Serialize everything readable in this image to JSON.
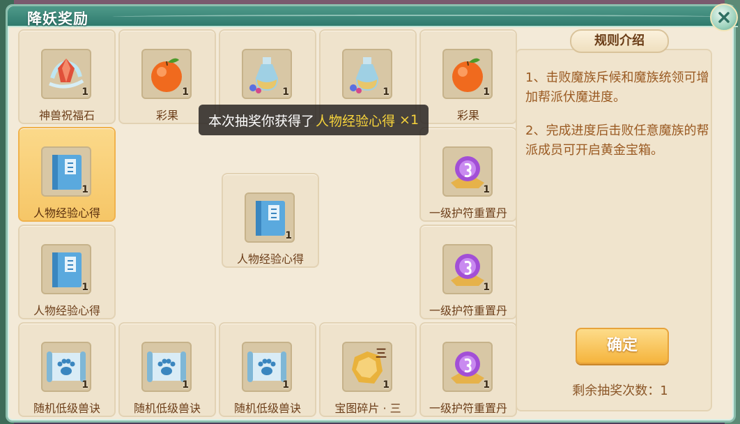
{
  "window": {
    "title": "降妖奖励"
  },
  "toast": {
    "prefix": "本次抽奖你获得了",
    "item": "人物经验心得",
    "multiplier": "×1"
  },
  "grid": {
    "cells": [
      {
        "label": "神兽祝福石",
        "qty": "1",
        "icon": "crystal-icon"
      },
      {
        "label": "彩果",
        "qty": "1",
        "icon": "fruit-icon"
      },
      {
        "label": "",
        "qty": "1",
        "icon": "potion-bottle-icon"
      },
      {
        "label": "",
        "qty": "1",
        "icon": "potion-bottle-icon"
      },
      {
        "label": "彩果",
        "qty": "1",
        "icon": "fruit-icon"
      },
      {
        "label": "人物经验心得",
        "qty": "1",
        "icon": "experience-book-icon",
        "selected": true
      },
      {
        "label": "一级护符重置丹",
        "qty": "1",
        "icon": "purple-orb-icon"
      },
      {
        "label": "人物经验心得",
        "qty": "1",
        "icon": "experience-book-icon"
      },
      {
        "label": "一级护符重置丹",
        "qty": "1",
        "icon": "purple-orb-icon"
      },
      {
        "label": "随机低级兽诀",
        "qty": "1",
        "icon": "paw-scroll-icon"
      },
      {
        "label": "随机低级兽诀",
        "qty": "1",
        "icon": "paw-scroll-icon"
      },
      {
        "label": "随机低级兽诀",
        "qty": "1",
        "icon": "paw-scroll-icon"
      },
      {
        "label": "宝图碎片 · 三",
        "qty": "1",
        "icon": "map-fragment-icon",
        "badge": "三"
      },
      {
        "label": "一级护符重置丹",
        "qty": "1",
        "icon": "purple-orb-icon"
      }
    ],
    "center": {
      "label": "人物经验心得",
      "qty": "1",
      "icon": "experience-book-icon"
    }
  },
  "rules": {
    "tag": "规则介绍",
    "line1": "1、击败魔族斥候和魔族统领可增加帮派伏魔进度。",
    "line2": "2、完成进度后击败任意魔族的帮派成员可开启黄金宝箱。"
  },
  "confirm_label": "确定",
  "remaining": "剩余抽奖次数：1",
  "colors": {
    "accent": "#f5b43d",
    "highlight": "#f7d43c",
    "title_bar": "#3f8a7c"
  }
}
